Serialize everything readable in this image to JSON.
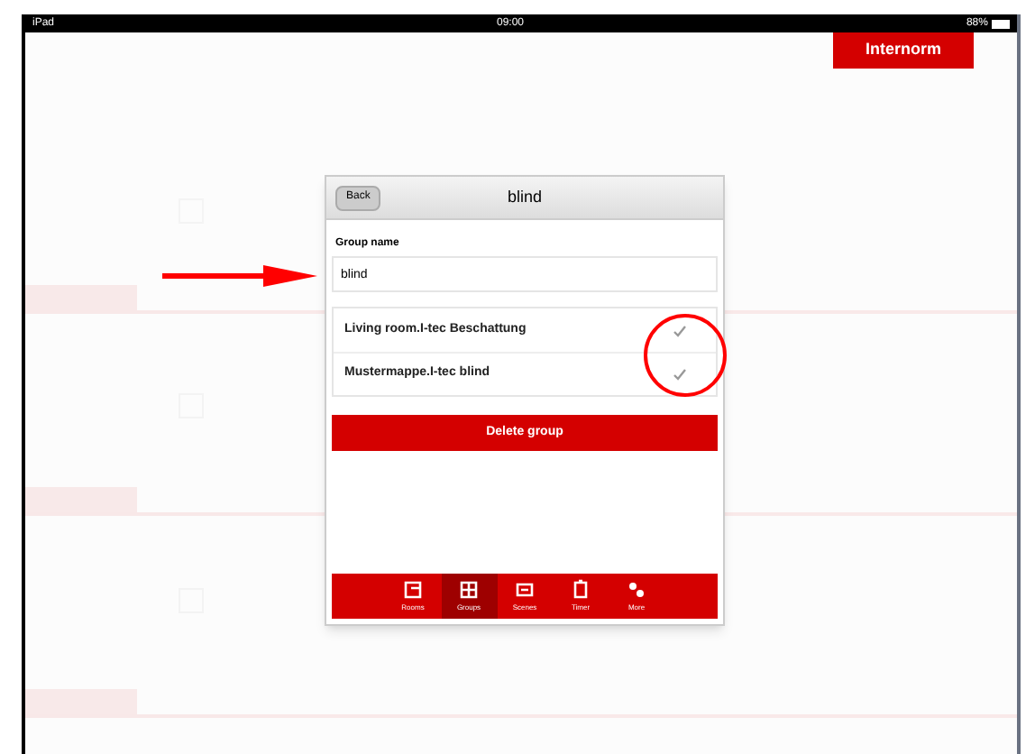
{
  "status_bar": {
    "device": "iPad",
    "time": "09:00",
    "battery": "88%"
  },
  "brand_button": "Internorm",
  "dialog": {
    "back": "Back",
    "title": "blind",
    "group_name_label": "Group name",
    "group_name_value": "blind",
    "members": [
      {
        "label": "Living room.I-tec Beschattung",
        "checked": true
      },
      {
        "label": "Mustermappe.I-tec blind",
        "checked": true
      }
    ],
    "delete_button": "Delete group",
    "tabs": [
      {
        "label": "Rooms",
        "selected": false,
        "kind": "rooms"
      },
      {
        "label": "Groups",
        "selected": true,
        "kind": "groups"
      },
      {
        "label": "Scenes",
        "selected": false,
        "kind": "scenes"
      },
      {
        "label": "Timer",
        "selected": false,
        "kind": "timer"
      },
      {
        "label": "More",
        "selected": false,
        "kind": "more"
      }
    ]
  }
}
